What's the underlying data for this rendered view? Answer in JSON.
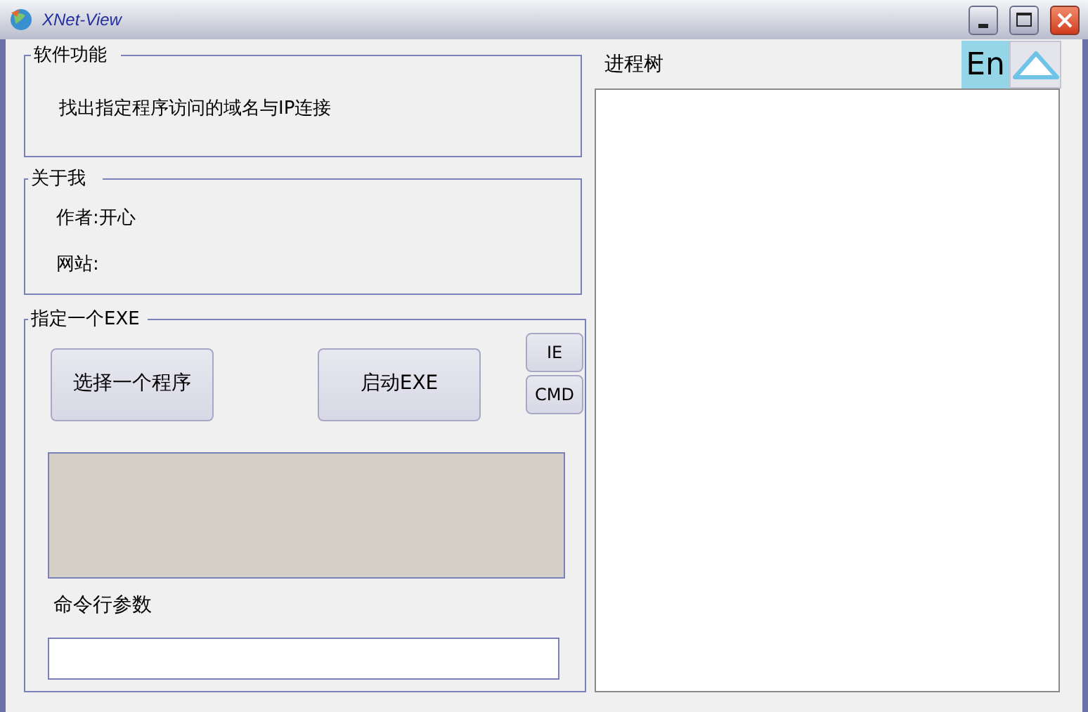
{
  "window": {
    "title": "XNet-View"
  },
  "features": {
    "legend": "软件功能",
    "text": "找出指定程序访问的域名与IP连接"
  },
  "about": {
    "legend": "关于我",
    "author": "作者:开心",
    "website": "网站:"
  },
  "exe": {
    "legend": "指定一个EXE",
    "select_button": "选择一个程序",
    "start_button": "启动EXE",
    "side_buttons": [
      "IE",
      "CMD"
    ],
    "args_label": "命令行参数"
  },
  "process_tree": {
    "label": "进程树"
  },
  "language_button": "En"
}
